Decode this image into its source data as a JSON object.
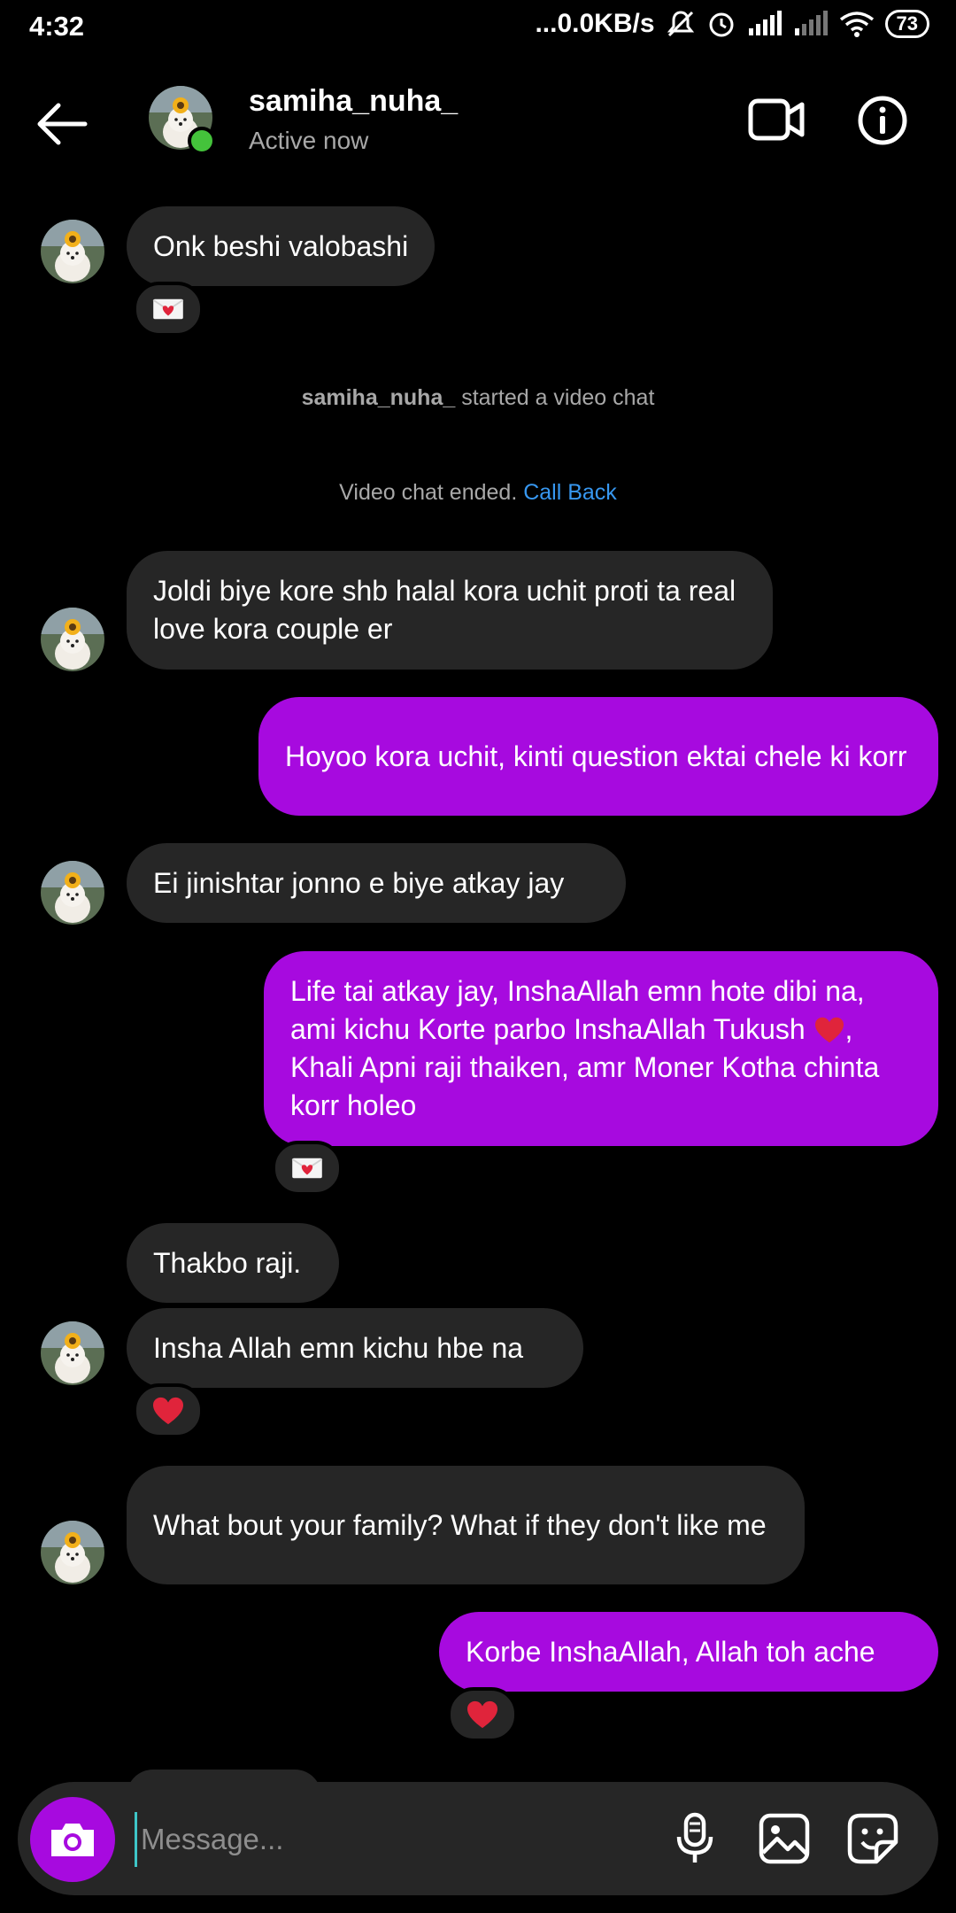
{
  "status_bar": {
    "time": "4:32",
    "network_speed": "...0.0KB/s",
    "battery": "73"
  },
  "header": {
    "name": "samiha_nuha_",
    "status": "Active now"
  },
  "messages": [
    {
      "text": "Onk beshi valobashi"
    },
    {
      "text": "Joldi biye kore shb halal kora uchit proti ta real love kora couple er"
    },
    {
      "text": "Hoyoo kora uchit, kinti question ektai chele ki korr"
    },
    {
      "text": "Ei jinishtar jonno e biye atkay jay"
    },
    {
      "text_a": "Life tai atkay jay, InshaAllah emn hote dibi na, ami kichu Korte parbo InshaAllah Tukush ",
      "text_b": ", Khali Apni raji thaiken, amr Moner Kotha chinta korr holeo"
    },
    {
      "text": "Thakbo raji."
    },
    {
      "text": "Insha Allah emn kichu hbe na"
    },
    {
      "text": "What bout your family? What if they don't like me"
    },
    {
      "text": "Korbe InshaAllah, Allah toh ache"
    }
  ],
  "system": {
    "video_started_name": "samiha_nuha_",
    "video_started_text": " started a video chat",
    "video_ended_text": "Video chat ended. ",
    "call_back": "Call Back"
  },
  "composer": {
    "placeholder": "Message..."
  },
  "icons": [
    "back-arrow-icon",
    "video-camera-icon",
    "info-icon",
    "camera-icon",
    "microphone-icon",
    "gallery-icon",
    "sticker-icon",
    "love-letter-icon",
    "heart-icon"
  ],
  "colors": {
    "outgoing_bubble": "#a70adf",
    "incoming_bubble": "#262626",
    "link": "#3797f0",
    "online": "#44c33b"
  }
}
